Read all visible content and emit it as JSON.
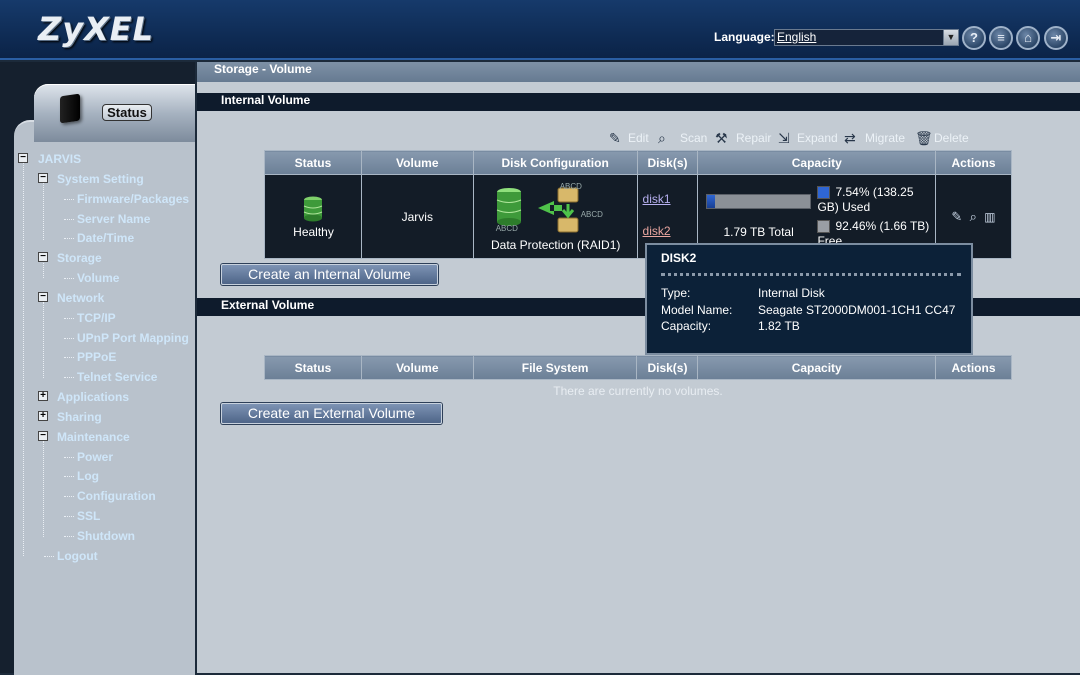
{
  "header": {
    "logo": "ZyXEL",
    "language_label": "Language:",
    "language_value": "English",
    "icons": [
      "help-icon",
      "notes-icon",
      "home-icon",
      "logout-icon"
    ]
  },
  "status_tab": {
    "label": "Status"
  },
  "tree": {
    "root": "JARVIS",
    "nodes": {
      "system_setting": "System Setting",
      "firmware": "Firmware/Packages",
      "server_name": "Server Name",
      "date_time": "Date/Time",
      "storage": "Storage",
      "volume": "Volume",
      "network": "Network",
      "tcpip": "TCP/IP",
      "upnp": "UPnP Port Mapping",
      "pppoe": "PPPoE",
      "telnet": "Telnet Service",
      "applications": "Applications",
      "sharing": "Sharing",
      "maintenance": "Maintenance",
      "power": "Power",
      "log": "Log",
      "configuration": "Configuration",
      "ssl": "SSL",
      "shutdown": "Shutdown",
      "logout": "Logout"
    }
  },
  "main": {
    "breadcrumb": "Storage - Volume",
    "internal_header": "Internal Volume",
    "external_header": "External Volume",
    "toolbar": {
      "edit": "Edit",
      "scan": "Scan",
      "repair": "Repair",
      "expand": "Expand",
      "migrate": "Migrate",
      "delete": "Delete"
    },
    "columns_internal": [
      "Status",
      "Volume",
      "Disk Configuration",
      "Disk(s)",
      "Capacity",
      "Actions"
    ],
    "columns_external": [
      "Status",
      "Volume",
      "File System",
      "Disk(s)",
      "Capacity",
      "Actions"
    ],
    "internal_row": {
      "status": "Healthy",
      "volume": "Jarvis",
      "disk_config": "Data Protection (RAID1)",
      "disk_icon_text": "ABCD",
      "disk1": "disk1",
      "disk2": "disk2",
      "total": "1.79 TB Total",
      "used": "7.54% (138.25 GB) Used",
      "free": "92.46% (1.66 TB) Free",
      "used_fraction": 0.0754
    },
    "external_empty": "There are currently no volumes.",
    "create_internal": "Create an Internal Volume",
    "create_external": "Create an External Volume"
  },
  "tooltip": {
    "title": "DISK2",
    "type_label": "Type:",
    "type_value": "Internal Disk",
    "model_label": "Model Name:",
    "model_value": "Seagate ST2000DM001-1CH1 CC47",
    "capacity_label": "Capacity:",
    "capacity_value": "1.82 TB"
  },
  "colors": {
    "used": "#2f66d4",
    "free": "#9a9ea4",
    "disk2_link": "#e9a6a0",
    "tree_link": "#cfe6f9"
  }
}
